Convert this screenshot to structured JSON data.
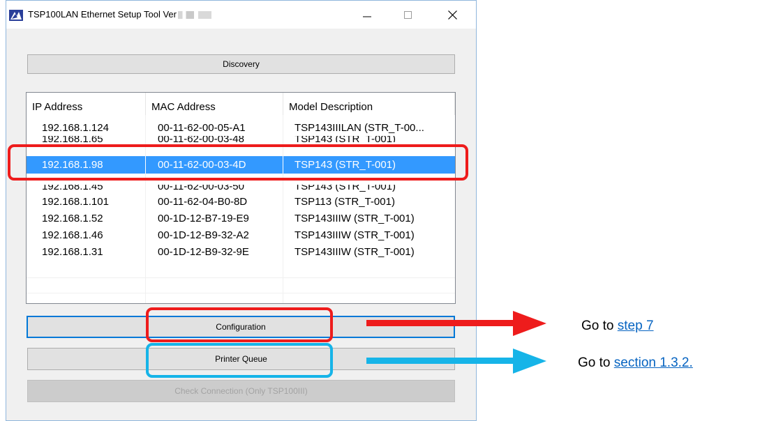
{
  "window": {
    "title": "TSP100LAN Ethernet Setup Tool Ver",
    "controls": {
      "minimize": "—",
      "maximize": "☐",
      "close": "✕"
    }
  },
  "buttons": {
    "discovery": "Discovery",
    "configuration": "Configuration",
    "printer_queue": "Printer Queue",
    "check_connection": "Check Connection (Only TSP100III)"
  },
  "table": {
    "columns": [
      "IP Address",
      "MAC Address",
      "Model Description"
    ],
    "rows": [
      {
        "ip": "192.168.1.124",
        "mac": "00-11-62-00-05-A1",
        "model": "TSP143IIILAN (STR_T-00..."
      },
      {
        "ip": "192.168.1.65",
        "mac": "00-11-62-00-03-48",
        "model": "TSP143 (STR_T-001)"
      },
      {
        "ip": "192.168.1.98",
        "mac": "00-11-62-00-03-4D",
        "model": "TSP143 (STR_T-001)"
      },
      {
        "ip": "192.168.1.45",
        "mac": "00-11-62-00-03-50",
        "model": "TSP143 (STR_T-001)"
      },
      {
        "ip": "192.168.1.101",
        "mac": "00-11-62-04-B0-8D",
        "model": "TSP113 (STR_T-001)"
      },
      {
        "ip": "192.168.1.52",
        "mac": "00-1D-12-B7-19-E9",
        "model": "TSP143IIIW (STR_T-001)"
      },
      {
        "ip": "192.168.1.46",
        "mac": "00-1D-12-B9-32-A2",
        "model": "TSP143IIIW (STR_T-001)"
      },
      {
        "ip": "192.168.1.31",
        "mac": "00-1D-12-B9-32-9E",
        "model": "TSP143IIIW (STR_T-001)"
      }
    ]
  },
  "annotations": {
    "go_to": "Go to",
    "step_link": "step 7",
    "section_link": "section 1.3.2.",
    "red_color": "#ee1c1c",
    "blue_color": "#16b4e8"
  }
}
